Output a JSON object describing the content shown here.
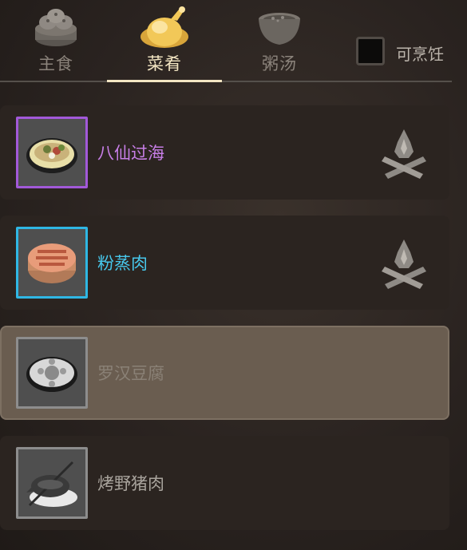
{
  "tabs": [
    {
      "label": "主食",
      "icon": "steamed-buns-icon",
      "active": false
    },
    {
      "label": "菜肴",
      "icon": "roast-dish-icon",
      "active": true
    },
    {
      "label": "粥汤",
      "icon": "soup-bowl-icon",
      "active": false
    }
  ],
  "cookable_filter": {
    "label": "可烹饪",
    "checked": false
  },
  "dishes": [
    {
      "name": "八仙过海",
      "name_color": "#c77ee6",
      "frame_color": "#a259d9",
      "icon": "eight-immortals-dish-icon",
      "cookable": true,
      "selected": false
    },
    {
      "name": "粉蒸肉",
      "name_color": "#47c7eb",
      "frame_color": "#2fb7e4",
      "icon": "steamed-pork-icon",
      "cookable": true,
      "selected": false
    },
    {
      "name": "罗汉豆腐",
      "name_color": "#8a8176",
      "frame_color": "#8c8c8c",
      "icon": "luohan-tofu-icon",
      "cookable": false,
      "selected": true
    },
    {
      "name": "烤野猪肉",
      "name_color": "#a8a39c",
      "frame_color": "#8c8c8c",
      "icon": "roast-boar-icon",
      "cookable": false,
      "selected": false
    }
  ]
}
